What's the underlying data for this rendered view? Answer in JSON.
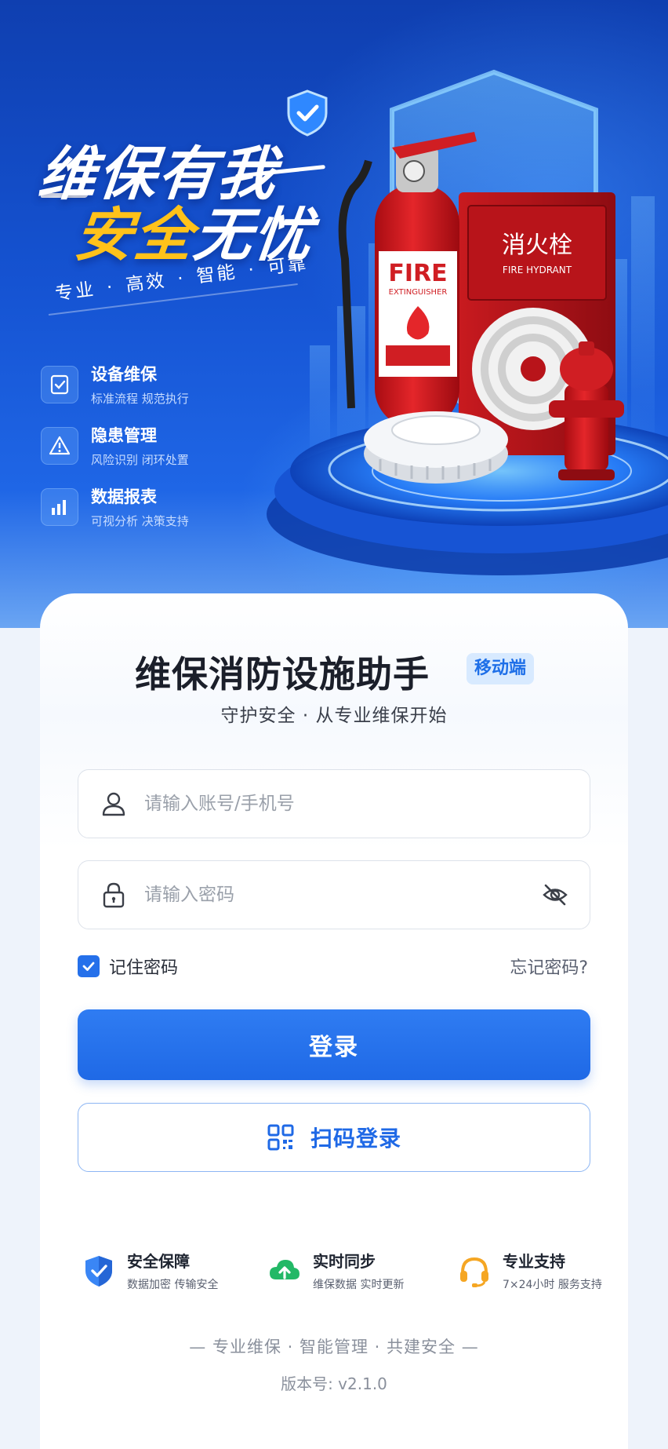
{
  "hero": {
    "title_line1": "维保有我",
    "title_line2_highlight": "安全",
    "title_line2_rest": "无忧",
    "slogan": "专业 · 高效 · 智能 · 可靠",
    "features": [
      {
        "icon": "checklist-icon",
        "title": "设备维保",
        "desc": "标准流程  规范执行"
      },
      {
        "icon": "warning-icon",
        "title": "隐患管理",
        "desc": "风险识别  闭环处置"
      },
      {
        "icon": "bar-chart-icon",
        "title": "数据报表",
        "desc": "可视分析  决策支持"
      }
    ],
    "product_labels": {
      "extinguisher_main": "FIRE",
      "extinguisher_sub": "EXTINGUISHER",
      "hydrant_cabinet_cn": "消火栓",
      "hydrant_cabinet_en": "FIRE HYDRANT"
    }
  },
  "login": {
    "app_title": "维保消防设施助手",
    "app_tag": "移动端",
    "subtitle": "守护安全 · 从专业维保开始",
    "account_placeholder": "请输入账号/手机号",
    "password_placeholder": "请输入密码",
    "remember_label": "记住密码",
    "remember_checked": true,
    "forgot_label": "忘记密码?",
    "login_button": "登录",
    "scan_button": "扫码登录"
  },
  "bottom_features": [
    {
      "icon": "shield-check-icon",
      "title": "安全保障",
      "desc": "数据加密  传输安全"
    },
    {
      "icon": "cloud-sync-icon",
      "title": "实时同步",
      "desc": "维保数据  实时更新"
    },
    {
      "icon": "headset-icon",
      "title": "专业支持",
      "desc": "7×24小时  服务支持"
    }
  ],
  "footer": {
    "tagline": "—   专业维保  ·  智能管理  ·  共建安全   —",
    "version": "版本号: v2.1.0"
  },
  "colors": {
    "primary": "#1f69e6",
    "hero_gold": "#ffc21a",
    "hero_blue": "#1553d2",
    "green": "#22b866",
    "orange": "#f5a623"
  }
}
